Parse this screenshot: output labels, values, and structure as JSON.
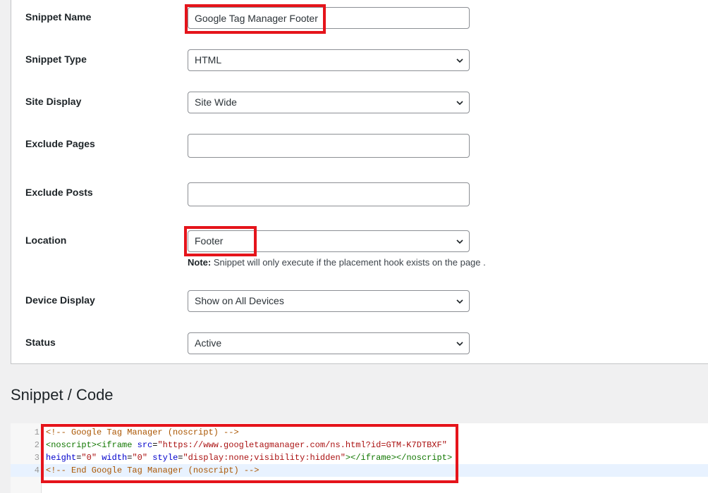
{
  "form": {
    "snippet_name": {
      "label": "Snippet Name",
      "value": "Google Tag Manager Footer"
    },
    "snippet_type": {
      "label": "Snippet Type",
      "value": "HTML"
    },
    "site_display": {
      "label": "Site Display",
      "value": "Site Wide"
    },
    "exclude_pages": {
      "label": "Exclude Pages",
      "value": ""
    },
    "exclude_posts": {
      "label": "Exclude Posts",
      "value": ""
    },
    "location": {
      "label": "Location",
      "value": "Footer",
      "note_prefix": "Note:",
      "note_text": " Snippet will only execute if the placement hook exists on the page ."
    },
    "device_display": {
      "label": "Device Display",
      "value": "Show on All Devices"
    },
    "status": {
      "label": "Status",
      "value": "Active"
    }
  },
  "code_section": {
    "title": "Snippet / Code",
    "line_numbers": [
      "1",
      "2",
      "3",
      "4"
    ],
    "lines": {
      "l1": "<!-- Google Tag Manager (noscript) -->",
      "l2_tag_open": "<noscript><iframe ",
      "l2_attr": "src",
      "l2_eq": "=",
      "l2_str": "\"https://www.googletagmanager.com/ns.html?id=GTM-K7DTBXF\"",
      "l3_attr1": "height",
      "l3_eq1": "=",
      "l3_str1": "\"0\"",
      "l3_attr2": "width",
      "l3_eq2": "=",
      "l3_str2": "\"0\"",
      "l3_attr3": "style",
      "l3_eq3": "=",
      "l3_str3": "\"display:none;visibility:hidden\"",
      "l3_tag_close": "></iframe></noscript>",
      "l4": "<!-- End Google Tag Manager (noscript) -->"
    }
  },
  "colors": {
    "highlight": "#e5141b",
    "comment": "#aa5500",
    "tag": "#117700",
    "attribute": "#0000cc",
    "string": "#aa1111"
  },
  "icons": {
    "select_arrow": "chevron-down-icon"
  }
}
